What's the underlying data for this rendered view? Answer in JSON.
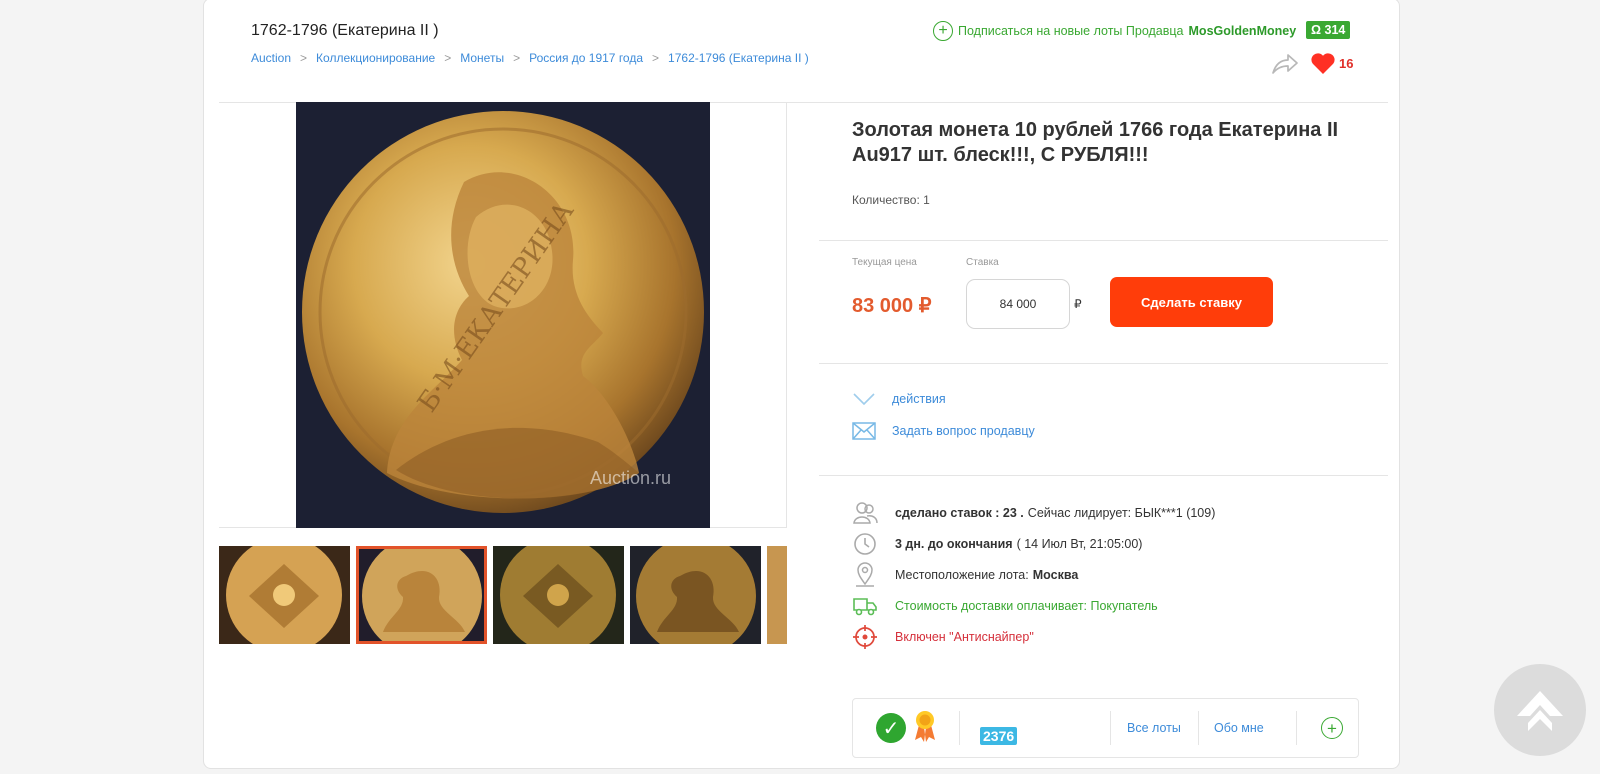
{
  "header": {
    "category_title": "1762-1796 (Екатерина II )",
    "breadcrumbs": [
      "Auction",
      "Коллекционирование",
      "Монеты",
      "Россия до 1917 года",
      "1762-1796 (Екатерина II )"
    ],
    "breadcrumb_separator": ">",
    "subscribe_text": "Подписаться на новые лоты Продавца",
    "seller_name": "MosGoldenMoney",
    "seller_rating_symbol": "Ω",
    "seller_rating": "314",
    "likes": "16"
  },
  "gallery": {
    "watermark": "Auction.ru",
    "main_image": "gold-coin-catherine-ii-obverse",
    "thumbnails": [
      "coin-reverse",
      "coin-obverse",
      "coin-reverse-dark",
      "coin-obverse-dark",
      "coin-partial"
    ],
    "active_thumbnail": 1
  },
  "lot": {
    "title": "Золотая монета 10 рублей 1766 года Екатерина II Au917 шт. блеск!!!, С РУБЛЯ!!!",
    "quantity": "Количество: 1",
    "current_price_label": "Текущая цена",
    "current_price": "83 000 ₽",
    "bid_label": "Ставка",
    "bid_value": "84 000",
    "currency": "₽",
    "bid_button": "Сделать ставку"
  },
  "actions": {
    "more": "действия",
    "ask_seller": "Задать вопрос продавцу"
  },
  "info": {
    "bids_made": "сделано ставок : 23 .",
    "leader": "Сейчас лидирует: БЫК***1 (109)",
    "time_left": "3 дн. до окончания",
    "end_date": "( 14 Июл Вт, 21:05:00)",
    "location_label": "Местоположение лота:",
    "location": "Москва",
    "delivery": "Стоимость доставки оплачивает: Покупатель",
    "antisniper": "Включен \"Антиснайпер\""
  },
  "seller_box": {
    "rating": "2376",
    "all_lots": "Все лоты",
    "about_me": "Обо мне"
  },
  "colors": {
    "accent_green": "#3aa832",
    "price_orange": "#e35b2e",
    "button_orange": "#ff3d0a",
    "link_blue": "#3d8bd9"
  }
}
